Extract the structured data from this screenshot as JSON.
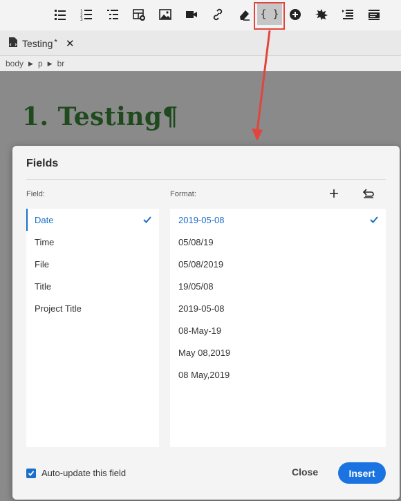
{
  "toolbar": {
    "icons": [
      "bulleted-list-icon",
      "numbered-list-icon",
      "outline-list-icon",
      "insert-table-icon",
      "image-icon",
      "video-icon",
      "link-icon",
      "eraser-icon",
      "fields-icon",
      "plus-circle-icon",
      "star-burst-icon",
      "indent-icon",
      "text-block-icon"
    ],
    "fields_glyph": "{ }"
  },
  "tab": {
    "label": "Testing",
    "modified_marker": "*",
    "close_glyph": "✕"
  },
  "breadcrumb": [
    "body",
    "p",
    "br"
  ],
  "document": {
    "heading": "1. Testing¶"
  },
  "dialog": {
    "title": "Fields",
    "field_label": "Field:",
    "format_label": "Format:",
    "fields": [
      "Date",
      "Time",
      "File",
      "Title",
      "Project Title"
    ],
    "selected_field": "Date",
    "formats": [
      "2019-05-08",
      "05/08/19",
      "05/08/2019",
      "19/05/08",
      "2019-05-08",
      "08-May-19",
      "May 08,2019",
      "08 May,2019"
    ],
    "auto_update_label": "Auto-update this field",
    "auto_update_checked": true,
    "close_label": "Close",
    "insert_label": "Insert"
  },
  "colors": {
    "accent": "#1a6fc9",
    "highlight": "#e2453c",
    "heading": "#1e4a1e"
  }
}
